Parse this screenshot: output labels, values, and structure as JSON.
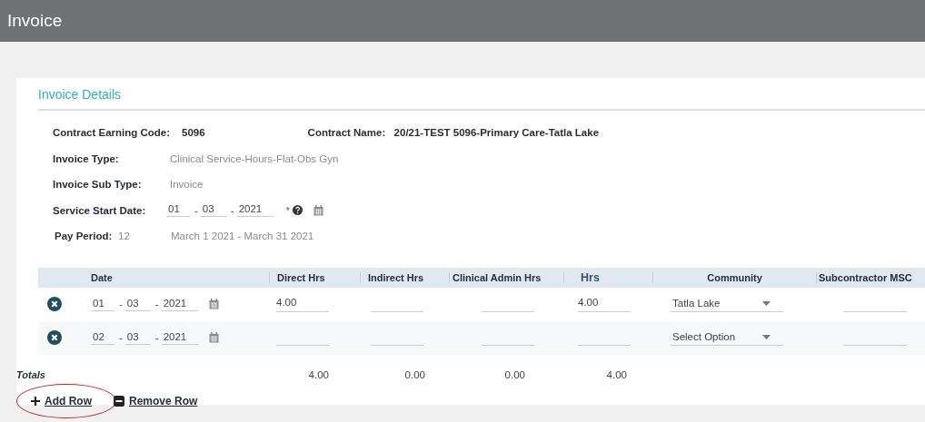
{
  "header": {
    "title": "Invoice"
  },
  "section": {
    "title": "Invoice Details"
  },
  "details": {
    "earning_code": {
      "label": "Contract Earning Code:",
      "value": "5096"
    },
    "contract_name": {
      "label": "Contract Name:",
      "value": "20/21-TEST 5096-Primary Care-Tatla Lake"
    },
    "invoice_type": {
      "label": "Invoice Type:",
      "value": "Clinical Service-Hours-Flat-Obs Gyn"
    },
    "invoice_sub_type": {
      "label": "Invoice Sub Type:",
      "value": "Invoice"
    },
    "service_start": {
      "label": "Service Start Date:",
      "day": "01",
      "month": "03",
      "year": "2021",
      "separator": "-",
      "required_mark": "*"
    },
    "pay_period": {
      "label": "Pay Period:",
      "value": "12",
      "range": "March 1 2021 - March 31 2021"
    }
  },
  "table": {
    "columns": [
      {
        "label": "Date",
        "highlighted": false
      },
      {
        "label": "Direct Hrs",
        "highlighted": false
      },
      {
        "label": "Indirect Hrs",
        "highlighted": false
      },
      {
        "label": "Clinical Admin Hrs",
        "highlighted": false
      },
      {
        "label": "Hrs",
        "highlighted": true
      },
      {
        "label": "Community",
        "highlighted": false
      },
      {
        "label": "Subcontractor MSC",
        "highlighted": false
      }
    ],
    "rows": [
      {
        "date": {
          "day": "01",
          "month": "03",
          "year": "2021",
          "separator": "-"
        },
        "direct": "4.00",
        "hrs": "4.00",
        "community": {
          "value": "Tatla Lake"
        }
      },
      {
        "date": {
          "day": "02",
          "month": "03",
          "year": "2021",
          "separator": "-"
        },
        "community": {
          "placeholder": "Select Option"
        }
      }
    ],
    "totals": {
      "label": "Totals",
      "direct": "4.00",
      "indirect": "0.00",
      "clinical": "0.00",
      "hrs": "4.00"
    }
  },
  "actions": [
    {
      "kind": "add",
      "label": "Add Row",
      "circled": true
    },
    {
      "kind": "remove",
      "label": "Remove Row",
      "circled": false
    }
  ]
}
